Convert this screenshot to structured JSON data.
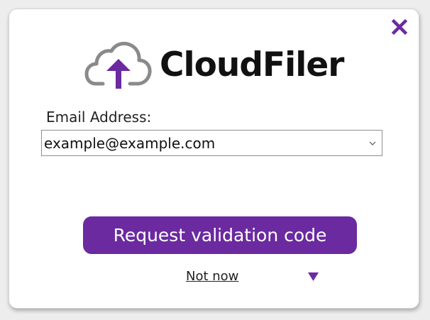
{
  "app": {
    "name": "CloudFiler",
    "logo_icon": "cloud-upload-icon"
  },
  "form": {
    "email_label": "Email Address:",
    "email_value": "example@example.com",
    "dropdown_icon": "chevron-down-icon"
  },
  "actions": {
    "request_label": "Request validation code",
    "not_now_label": "Not now",
    "close_icon": "close-icon",
    "more_icon": "triangle-down-icon"
  },
  "colors": {
    "accent": "#6b2aa0",
    "cloud_outline": "#8a8a8a",
    "text": "#111111"
  }
}
